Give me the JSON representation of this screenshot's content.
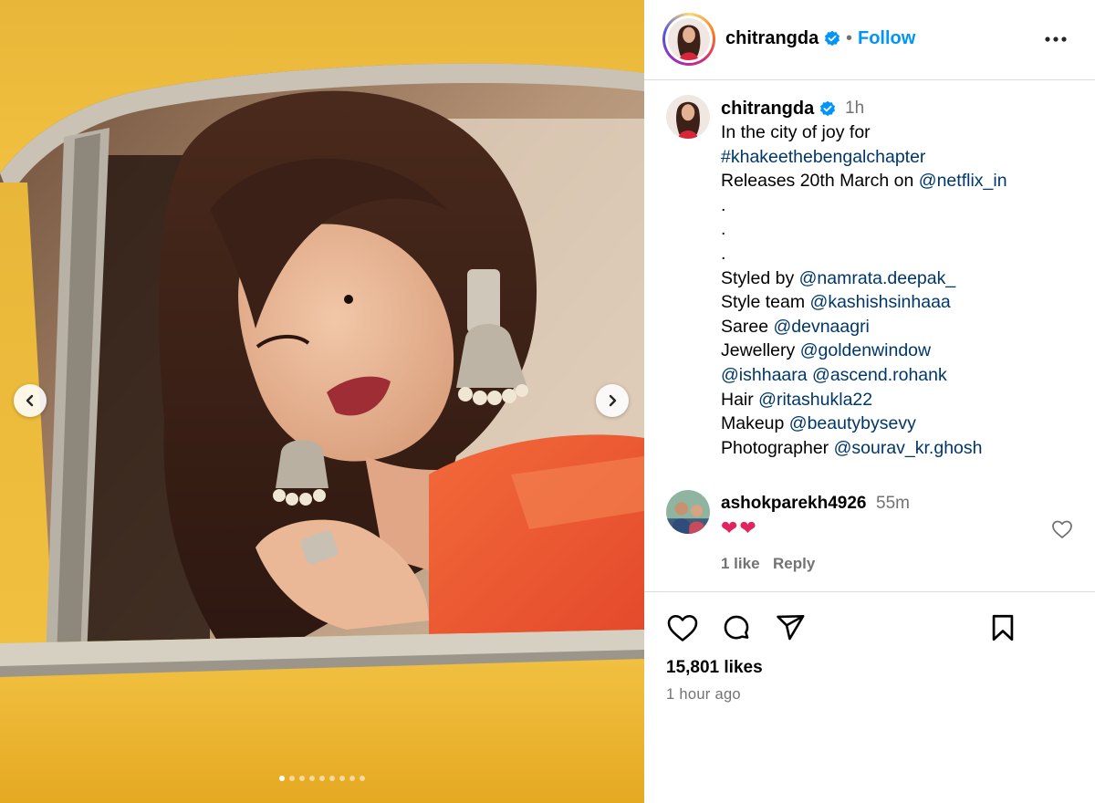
{
  "media": {
    "slide_count": 9,
    "active_slide_index": 0,
    "prev_icon": "chevron-left-icon",
    "next_icon": "chevron-right-icon"
  },
  "header": {
    "username": "chitrangda",
    "separator": "•",
    "follow_label": "Follow",
    "verified_icon": "verified-badge-icon",
    "more_icon": "more-options-icon"
  },
  "caption": {
    "username": "chitrangda",
    "time": "1h",
    "lines": [
      [
        {
          "t": "In the city of joy for"
        }
      ],
      [
        {
          "t": "#khakeethebengalchapter",
          "link": true
        }
      ],
      [
        {
          "t": "Releases 20th March on "
        },
        {
          "t": "@netflix_in",
          "link": true
        }
      ],
      [
        {
          "t": "."
        }
      ],
      [
        {
          "t": "."
        }
      ],
      [
        {
          "t": "."
        }
      ],
      [
        {
          "t": "Styled by "
        },
        {
          "t": "@namrata.deepak_",
          "link": true
        }
      ],
      [
        {
          "t": "Style team "
        },
        {
          "t": "@kashishsinhaaa",
          "link": true
        }
      ],
      [
        {
          "t": "Saree "
        },
        {
          "t": "@devnaagri",
          "link": true
        }
      ],
      [
        {
          "t": "Jewellery "
        },
        {
          "t": "@goldenwindow",
          "link": true
        }
      ],
      [
        {
          "t": "@ishhaara",
          "link": true
        },
        {
          "t": " "
        },
        {
          "t": "@ascend.rohank",
          "link": true
        }
      ],
      [
        {
          "t": "Hair "
        },
        {
          "t": "@ritashukla22",
          "link": true
        }
      ],
      [
        {
          "t": "Makeup "
        },
        {
          "t": "@beautybysevy",
          "link": true
        }
      ],
      [
        {
          "t": "Photographer "
        },
        {
          "t": "@sourav_kr.ghosh",
          "link": true
        }
      ]
    ]
  },
  "comment": {
    "username": "ashokparekh4926",
    "time": "55m",
    "text": "❤❤",
    "likes_label": "1 like",
    "reply_label": "Reply",
    "like_icon": "heart-outline-icon"
  },
  "actions": {
    "like_icon": "heart-icon",
    "comment_icon": "comment-icon",
    "share_icon": "share-icon",
    "save_icon": "bookmark-icon",
    "likes": "15,801 likes",
    "posted": "1 hour ago"
  },
  "colors": {
    "link": "#00376b",
    "follow": "#0095f6",
    "muted": "#737373",
    "verified": "#0095f6",
    "heart": "#e0245e"
  }
}
